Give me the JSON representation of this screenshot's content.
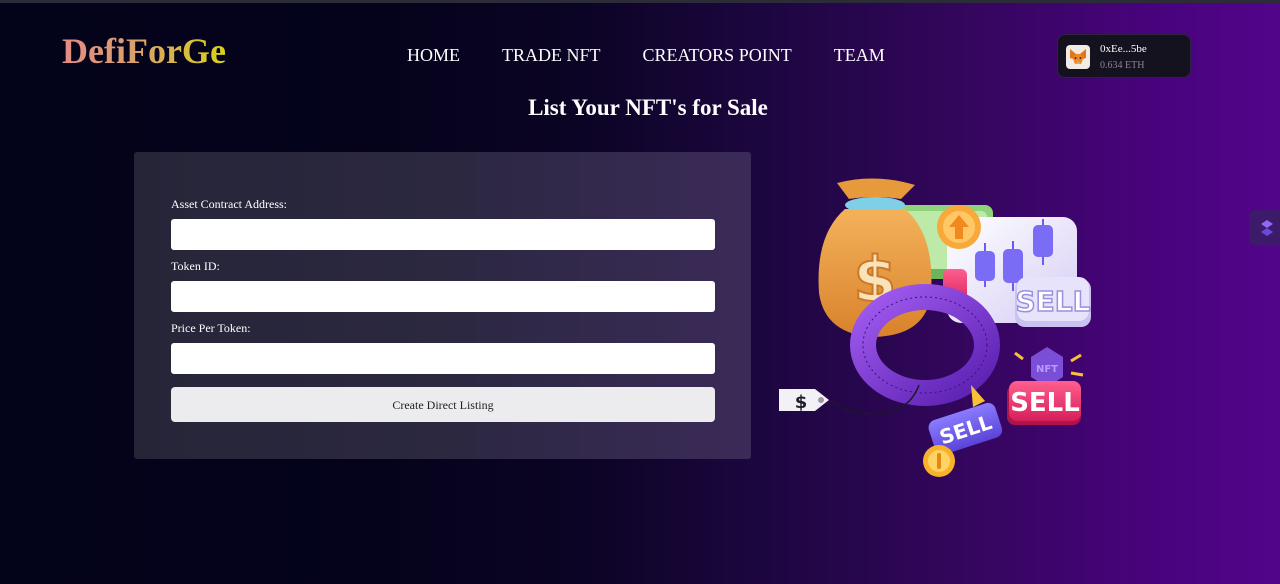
{
  "brand": {
    "logo": "DefiForGe"
  },
  "nav": {
    "items": [
      {
        "label": "HOME"
      },
      {
        "label": "TRADE NFT"
      },
      {
        "label": "CREATORS POINT"
      },
      {
        "label": "TEAM"
      }
    ]
  },
  "wallet": {
    "icon": "metamask-fox-icon",
    "address": "0xEe...5be",
    "balance": "0.634 ETH"
  },
  "page": {
    "title": "List Your NFT's for Sale"
  },
  "form": {
    "contract_label": "Asset Contract Address:",
    "contract_value": "",
    "token_label": "Token ID:",
    "token_value": "",
    "price_label": "Price Per Token:",
    "price_value": "",
    "submit_label": "Create Direct Listing"
  },
  "illustration": {
    "sell_big": "SELL",
    "sell_right": "SELL",
    "sell_tag": "SELL",
    "nft_badge": "NFT",
    "dollar": "$",
    "tag_dollar": "$"
  },
  "colors": {
    "accent_purple": "#52058a",
    "background_dark": "#03031a",
    "card": "#2b2840"
  }
}
